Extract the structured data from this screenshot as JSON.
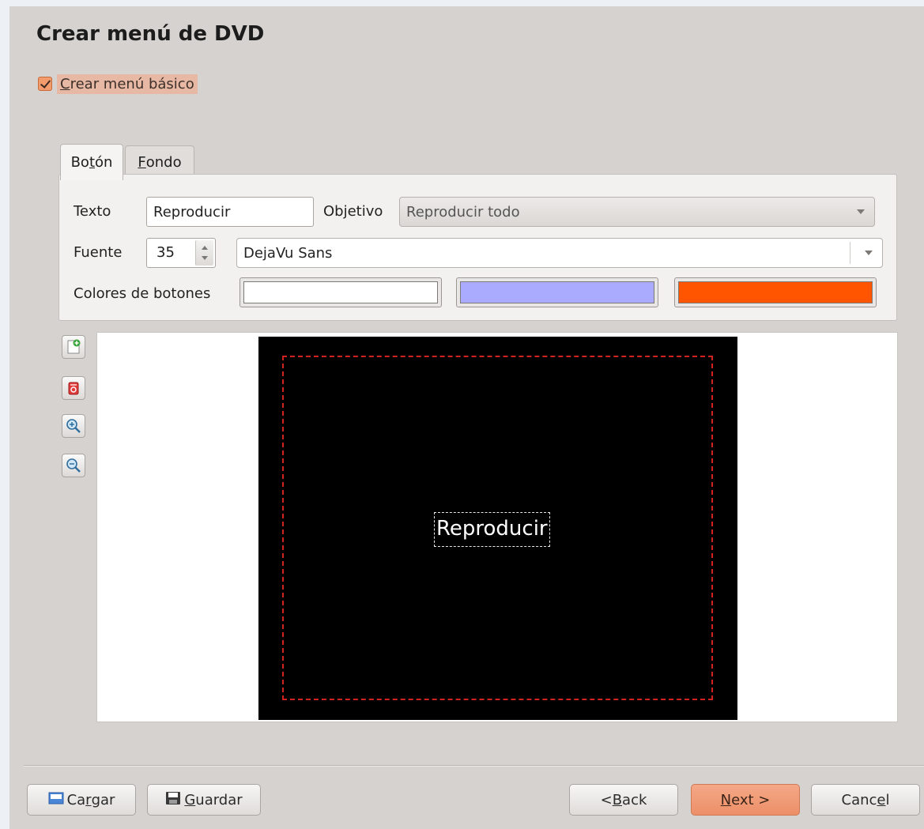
{
  "page": {
    "title": "Crear menú de DVD"
  },
  "basic_menu": {
    "prefix": "",
    "accel": "C",
    "rest": "rear menú básico",
    "checked": true
  },
  "tabs": [
    {
      "pre": "Bo",
      "accel": "t",
      "post": "ón",
      "active": true
    },
    {
      "pre": "",
      "accel": "F",
      "post": "ondo",
      "active": false
    }
  ],
  "button_tab": {
    "text_label": "Texto",
    "text_value": "Reproducir",
    "target_label": "Objetivo",
    "target_value": "Reproducir todo",
    "font_label": "Fuente",
    "font_size": "35",
    "font_family": "DejaVu Sans",
    "colors_label": "Colores de botones",
    "colors": [
      "#ffffff",
      "#aaaaff",
      "#ff5500"
    ]
  },
  "toolbar": {
    "icons": [
      "add-button-icon",
      "delete-button-icon",
      "zoom-in-icon",
      "zoom-out-icon"
    ]
  },
  "preview": {
    "button_text": "Reproducir",
    "background": "#000000",
    "safe_area_color": "#d0231f"
  },
  "footer": {
    "load": {
      "pre": "Ca",
      "accel": "r",
      "post": "gar"
    },
    "save": {
      "pre": "",
      "accel": "G",
      "post": "uardar"
    },
    "back": {
      "pre": "< ",
      "accel": "B",
      "post": "ack"
    },
    "next": {
      "pre": "",
      "accel": "N",
      "post": "ext >"
    },
    "cancel": {
      "pre": "Canc",
      "accel": "e",
      "post": "l"
    }
  },
  "colors": {
    "accent": "#ec8f68",
    "dialog_bg": "#d6d2cf"
  }
}
